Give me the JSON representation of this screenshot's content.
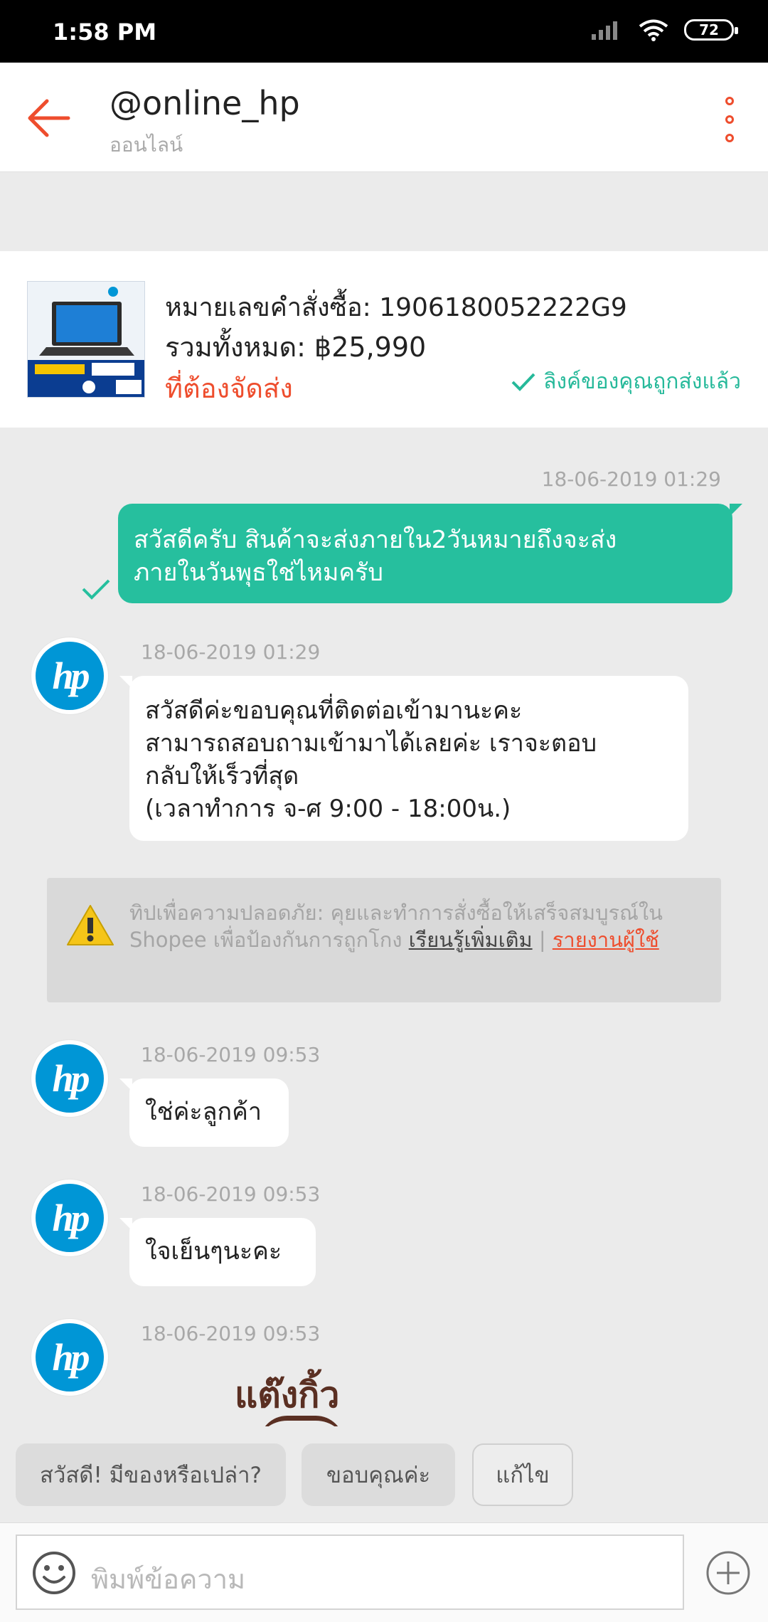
{
  "status": {
    "time": "1:58 PM",
    "battery": "72"
  },
  "header": {
    "title": "@online_hp",
    "subtitle": "ออนไลน์"
  },
  "order": {
    "number_line": "หมายเลขคำสั่งซื้อ: 1906180052222G9",
    "total_line": "รวมทั้งหมด: ฿25,990",
    "status": "ที่ต้องจัดส่ง",
    "link_sent": "ลิงค์ของคุณถูกส่งแล้ว"
  },
  "messages": [
    {
      "timestamp": "18-06-2019 01:29",
      "lines": [
        "สวัสดีครับ สินค้าจะส่งภายใน2วันหมายถึงจะส่ง",
        "ภายในวันพุธใช่ไหมครับ"
      ]
    },
    {
      "timestamp": "18-06-2019 01:29",
      "lines": [
        "สวัสดีค่ะขอบคุณที่ติดต่อเข้ามานะคะ",
        "สามารถสอบถามเข้ามาได้เลยค่ะ เราจะตอบ",
        "กลับให้เร็วที่สุด",
        "(เวลาทำการ จ-ศ 9:00 - 18:00น.)"
      ]
    },
    {
      "timestamp": "18-06-2019 09:53",
      "text": "ใช่ค่ะลูกค้า"
    },
    {
      "timestamp": "18-06-2019 09:53",
      "text": "ใจเย็นๆนะคะ"
    },
    {
      "timestamp": "18-06-2019 09:53",
      "sticker_text": "แต๊งกิ้ว"
    }
  ],
  "avatar_text": "hp",
  "tip": {
    "text": "ทิปเพื่อความปลอดภัย: คุยและทำการสั่งซื้อให้เสร็จสมบูรณ์ใน Shopee เพื่อป้องกันการถูกโกง",
    "learn_more": "เรียนรู้เพิ่มเติม",
    "separator": "|",
    "report": "รายงานผู้ใช้"
  },
  "quick_replies": [
    "สวัสดี! มีของหรือเปล่า?",
    "ขอบคุณค่ะ",
    "แก้ไข"
  ],
  "input": {
    "placeholder": "พิมพ์ข้อความ"
  },
  "colors": {
    "accent": "#ee4d2d",
    "outgoing": "#26bf9e",
    "hp_blue": "#0096d6"
  }
}
